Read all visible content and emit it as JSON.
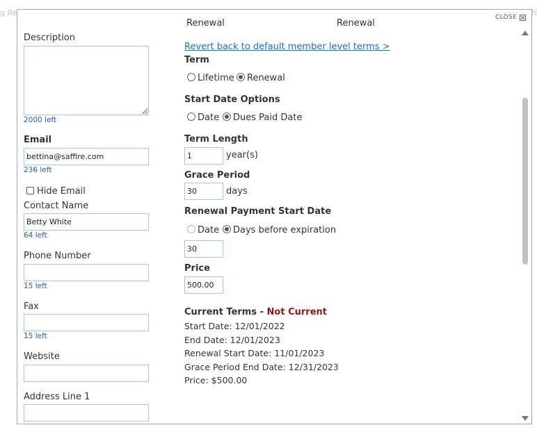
{
  "background": {
    "left_fragment": "g Re",
    "right_fragment": "N"
  },
  "modal": {
    "close_label": "CLOSE"
  },
  "left_col": {
    "description_label": "Description",
    "description_value": "",
    "description_counter": "2000 left",
    "email_label": "Email",
    "email_value": "bettina@saffire.com",
    "email_counter": "236 left",
    "hide_email_label": "Hide Email",
    "contact_name_label": "Contact Name",
    "contact_name_value": "Betty White",
    "contact_name_counter": "64 left",
    "phone_label": "Phone Number",
    "phone_value": "",
    "phone_counter": "15 left",
    "fax_label": "Fax",
    "fax_value": "",
    "fax_counter": "15 left",
    "website_label": "Website",
    "website_value": "",
    "address1_label": "Address Line 1",
    "address1_value": ""
  },
  "right_col": {
    "cut_header_left": "Renewal",
    "cut_header_right": "Renewal",
    "revert_link": "Revert back to default member level terms >",
    "term_label": "Term",
    "term_options": [
      "Lifetime",
      "Renewal"
    ],
    "term_selected": "Renewal",
    "start_date_label": "Start Date Options",
    "start_date_options": [
      "Date",
      "Dues Paid Date"
    ],
    "start_date_selected": "Dues Paid Date",
    "term_length_label": "Term Length",
    "term_length_value": "1",
    "term_length_unit": "year(s)",
    "grace_period_label": "Grace Period",
    "grace_period_value": "30",
    "grace_period_unit": "days",
    "renewal_payment_label": "Renewal Payment Start Date",
    "renewal_payment_options": [
      "Date",
      "Days before expiration"
    ],
    "renewal_payment_selected": "Days before expiration",
    "renewal_payment_value": "30",
    "price_label": "Price",
    "price_value": "500.00",
    "current_terms_label": "Current Terms - ",
    "current_terms_status": "Not Current",
    "start_date_line": "Start Date: 12/01/2022",
    "end_date_line": "End Date: 12/01/2023",
    "renewal_start_line": "Renewal Start Date: 11/01/2023",
    "grace_end_line": "Grace Period End Date: 12/31/2023",
    "price_line": "Price: $500.00"
  },
  "colors": {
    "link": "#2a6ab3",
    "counter": "#2a5da8",
    "status_red": "#8b1a1a",
    "field_border": "#a9c4de"
  }
}
